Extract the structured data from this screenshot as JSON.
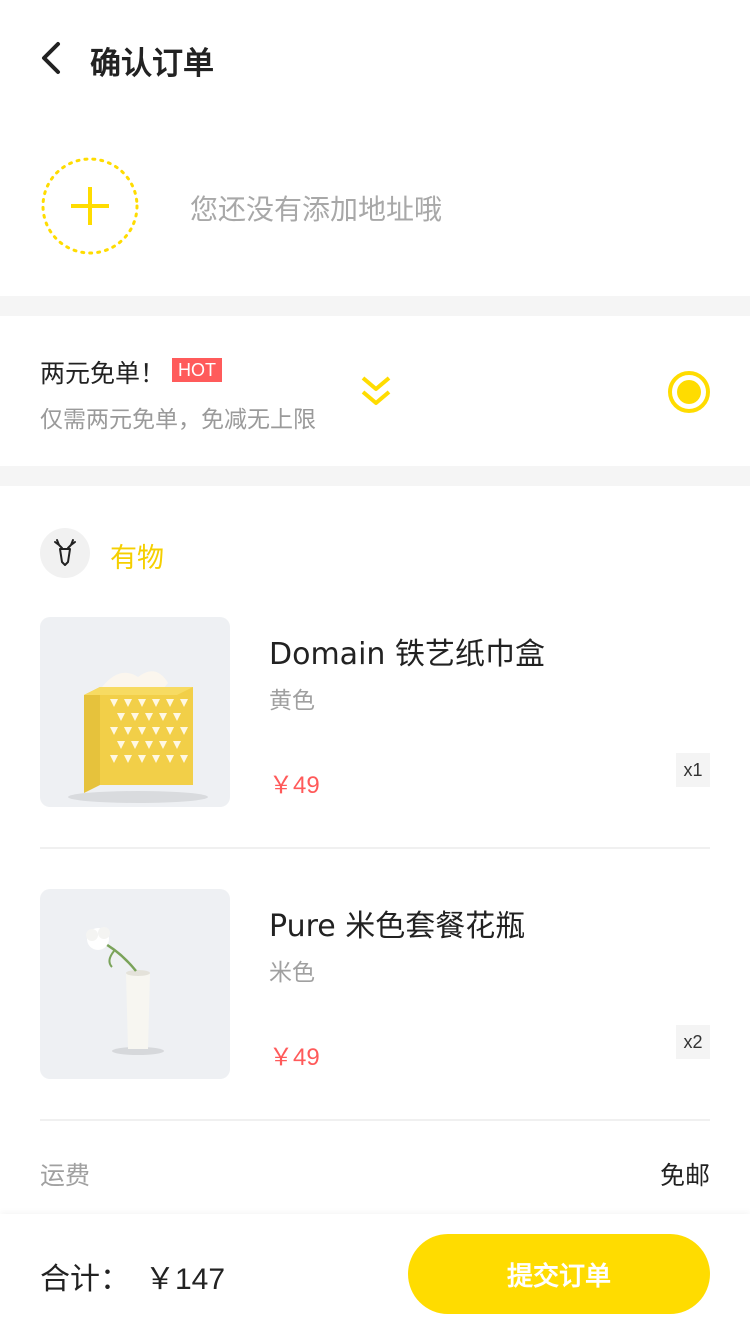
{
  "header": {
    "title": "确认订单"
  },
  "address": {
    "empty_text": "您还没有添加地址哦"
  },
  "promo": {
    "title": "两元免单！",
    "badge": "HOT",
    "subtitle": "仅需两元免单，免减无上限"
  },
  "shop": {
    "name": "有物",
    "items": [
      {
        "name": "Domain 铁艺纸巾盒",
        "variant": "黄色",
        "price": "￥49",
        "qty": "x1"
      },
      {
        "name": "Pure 米色套餐花瓶",
        "variant": "米色",
        "price": "￥49",
        "qty": "x2"
      }
    ],
    "shipping_label": "运费",
    "shipping_value": "免邮"
  },
  "footer": {
    "total_label": "合计：",
    "total_value": "￥147",
    "submit_label": "提交订单"
  },
  "colors": {
    "accent": "#ffdc00",
    "price": "#ff5a5a",
    "hot": "#ff5b5b"
  }
}
